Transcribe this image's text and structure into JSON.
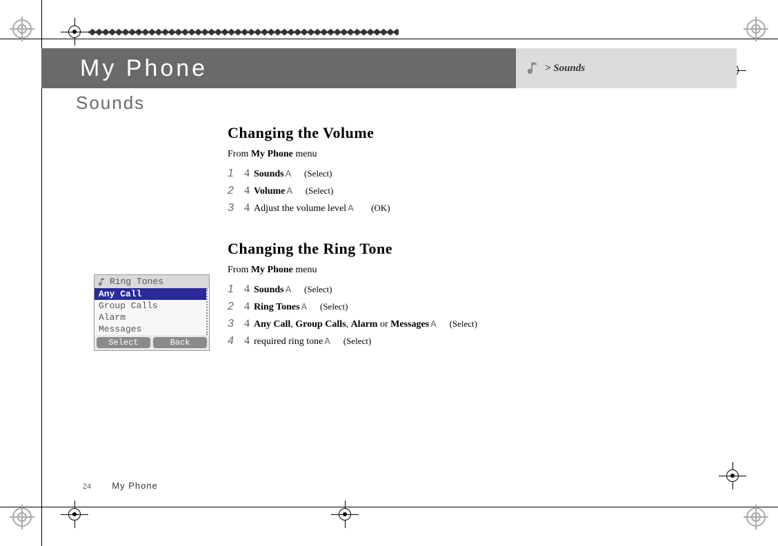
{
  "banner": {
    "chapter": "My Phone",
    "breadcrumb_gt": ">",
    "breadcrumb_section": "Sounds"
  },
  "section_title": "Sounds",
  "block1": {
    "heading": "Changing the Volume",
    "from_prefix": "From ",
    "from_menu": "My Phone",
    "from_suffix": " menu",
    "steps": [
      {
        "n": "1",
        "bold": "Sounds",
        "tail": "",
        "soft": "Select"
      },
      {
        "n": "2",
        "bold": "Volume",
        "tail": "",
        "soft": "Select"
      },
      {
        "n": "3",
        "bold": "",
        "tail": "Adjust the volume level",
        "soft": "OK"
      }
    ]
  },
  "block2": {
    "heading": "Changing the Ring Tone",
    "from_prefix": "From ",
    "from_menu": "My Phone",
    "from_suffix": " menu",
    "steps": [
      {
        "n": "1",
        "bold": "Sounds",
        "tail": "",
        "soft": "Select"
      },
      {
        "n": "2",
        "bold": "Ring Tones",
        "tail": "",
        "soft": "Select"
      },
      {
        "n": "3",
        "bold_multi": [
          "Any Call",
          "Group Calls",
          "Alarm",
          "Messages"
        ],
        "joins": [
          ", ",
          ", ",
          " or "
        ],
        "soft": "Select"
      },
      {
        "n": "4",
        "bold": "",
        "tail": "required ring tone",
        "soft": "Select"
      }
    ]
  },
  "phone_inset": {
    "title": "Ring Tones",
    "rows": [
      "Any Call",
      "Group Calls",
      "Alarm",
      "Messages"
    ],
    "selected_index": 0,
    "soft_left": "Select",
    "soft_right": "Back"
  },
  "footer": {
    "page": "24",
    "chapter": "My Phone"
  },
  "glyphs": {
    "arrow": "▸",
    "icon_a": "A"
  }
}
